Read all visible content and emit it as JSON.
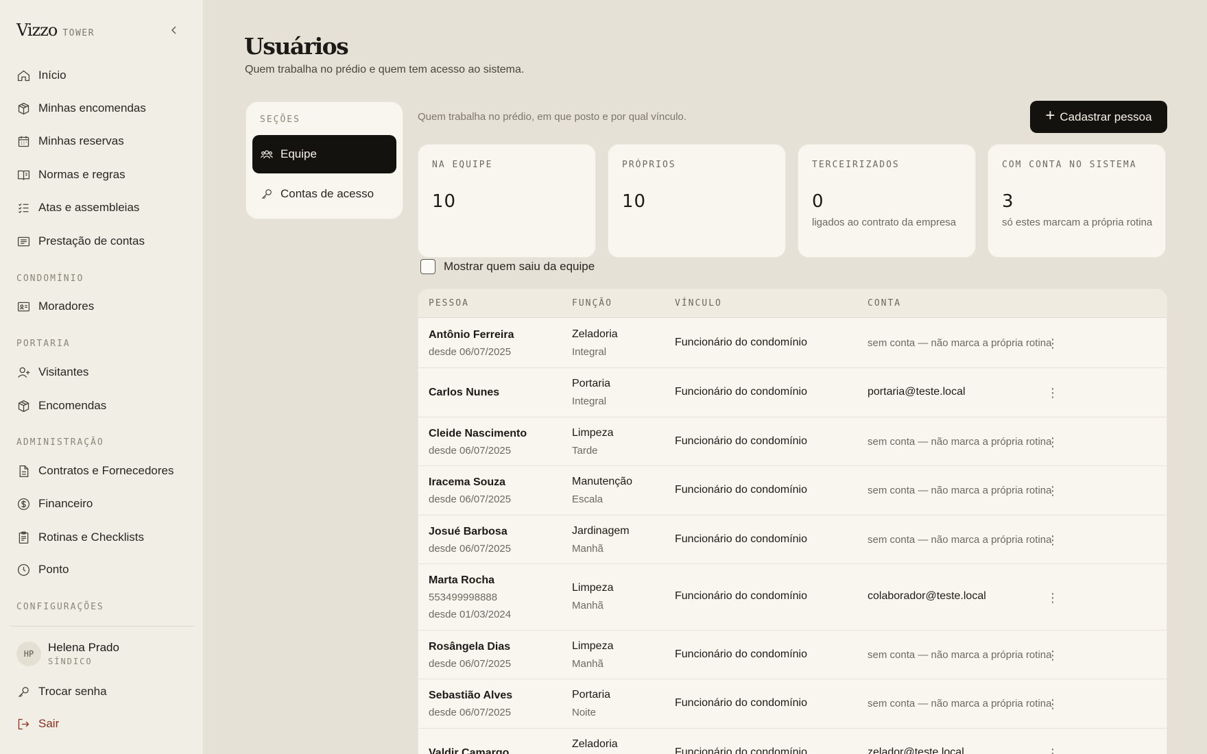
{
  "brand": {
    "name": "Vizzo",
    "sub": "TOWER"
  },
  "nav": {
    "top": [
      {
        "label": "Início",
        "icon": "home-icon"
      },
      {
        "label": "Minhas encomendas",
        "icon": "package-icon"
      },
      {
        "label": "Minhas reservas",
        "icon": "calendar-icon"
      },
      {
        "label": "Normas e regras",
        "icon": "book-icon"
      },
      {
        "label": "Atas e assembleias",
        "icon": "checklist-icon"
      },
      {
        "label": "Prestação de contas",
        "icon": "receipt-icon"
      }
    ],
    "sections": {
      "condominio": "CONDOMÍNIO",
      "portaria": "PORTARIA",
      "administracao": "ADMINISTRAÇÃO",
      "configuracoes": "CONFIGURAÇÕES"
    },
    "condominio": [
      {
        "label": "Moradores",
        "icon": "id-card-icon"
      }
    ],
    "portaria": [
      {
        "label": "Visitantes",
        "icon": "user-plus-icon"
      },
      {
        "label": "Encomendas",
        "icon": "package-icon"
      }
    ],
    "administracao": [
      {
        "label": "Contratos e Fornecedores",
        "icon": "document-icon"
      },
      {
        "label": "Financeiro",
        "icon": "dollar-icon"
      },
      {
        "label": "Rotinas e Checklists",
        "icon": "clipboard-icon"
      },
      {
        "label": "Ponto",
        "icon": "clock-icon"
      }
    ]
  },
  "user": {
    "initials": "HP",
    "name": "Helena Prado",
    "role": "SÍNDICO"
  },
  "account": {
    "change_password": "Trocar senha",
    "logout": "Sair"
  },
  "page": {
    "title": "Usuários",
    "subtitle": "Quem trabalha no prédio e quem tem acesso ao sistema."
  },
  "sections_panel": {
    "label": "SEÇÕES",
    "items": [
      {
        "label": "Equipe",
        "active": true
      },
      {
        "label": "Contas de acesso",
        "active": false
      }
    ]
  },
  "intro": "Quem trabalha no prédio, em que posto e por qual vínculo.",
  "primary_action": "Cadastrar pessoa",
  "stats": [
    {
      "label": "NA EQUIPE",
      "value": "10",
      "note": ""
    },
    {
      "label": "PRÓPRIOS",
      "value": "10",
      "note": ""
    },
    {
      "label": "TERCEIRIZADOS",
      "value": "0",
      "note": "ligados ao contrato da empresa"
    },
    {
      "label": "COM CONTA NO SISTEMA",
      "value": "3",
      "note": "só estes marcam a própria rotina"
    }
  ],
  "toggle_label": "Mostrar quem saiu da equipe",
  "table": {
    "headers": [
      "PESSOA",
      "FUNÇÃO",
      "VÍNCULO",
      "CONTA"
    ],
    "rows": [
      {
        "name": "Antônio Ferreira",
        "extra": "",
        "since": "desde 06/07/2025",
        "role": "Zeladoria",
        "shift": "Integral",
        "bond": "Funcionário do condomínio",
        "account": "sem conta — não marca a própria rotina",
        "has_account": false
      },
      {
        "name": "Carlos Nunes",
        "extra": "",
        "since": "",
        "role": "Portaria",
        "shift": "Integral",
        "bond": "Funcionário do condomínio",
        "account": "portaria@teste.local",
        "has_account": true
      },
      {
        "name": "Cleide Nascimento",
        "extra": "",
        "since": "desde 06/07/2025",
        "role": "Limpeza",
        "shift": "Tarde",
        "bond": "Funcionário do condomínio",
        "account": "sem conta — não marca a própria rotina",
        "has_account": false
      },
      {
        "name": "Iracema Souza",
        "extra": "",
        "since": "desde 06/07/2025",
        "role": "Manutenção",
        "shift": "Escala",
        "bond": "Funcionário do condomínio",
        "account": "sem conta — não marca a própria rotina",
        "has_account": false
      },
      {
        "name": "Josué Barbosa",
        "extra": "",
        "since": "desde 06/07/2025",
        "role": "Jardinagem",
        "shift": "Manhã",
        "bond": "Funcionário do condomínio",
        "account": "sem conta — não marca a própria rotina",
        "has_account": false
      },
      {
        "name": "Marta Rocha",
        "extra": "553499998888",
        "since": "desde 01/03/2024",
        "role": "Limpeza",
        "shift": "Manhã",
        "bond": "Funcionário do condomínio",
        "account": "colaborador@teste.local",
        "has_account": true
      },
      {
        "name": "Rosângela Dias",
        "extra": "",
        "since": "desde 06/07/2025",
        "role": "Limpeza",
        "shift": "Manhã",
        "bond": "Funcionário do condomínio",
        "account": "sem conta — não marca a própria rotina",
        "has_account": false
      },
      {
        "name": "Sebastião Alves",
        "extra": "",
        "since": "desde 06/07/2025",
        "role": "Portaria",
        "shift": "Noite",
        "bond": "Funcionário do condomínio",
        "account": "sem conta — não marca a própria rotina",
        "has_account": false
      },
      {
        "name": "Valdir Camargo",
        "extra": "",
        "since": "",
        "role": "Zeladoria",
        "shift": "",
        "bond": "Funcionário do condomínio",
        "account": "zelador@teste.local",
        "has_account": true
      }
    ]
  }
}
